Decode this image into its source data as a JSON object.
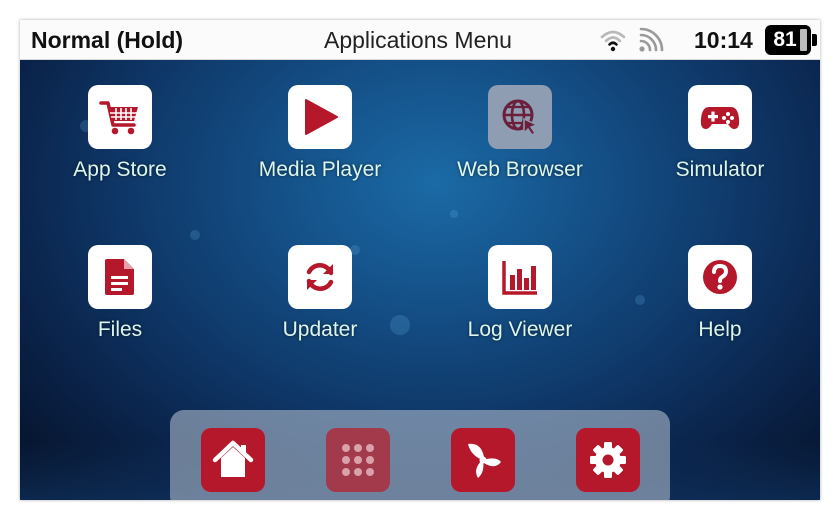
{
  "status_bar": {
    "mode": "Normal (Hold)",
    "title": "Applications Menu",
    "icons": [
      "wifi-icon",
      "cast-signal-icon"
    ],
    "time": "10:14",
    "battery_level": "81"
  },
  "apps": [
    {
      "label": "App Store",
      "icon": "shopping-cart-icon"
    },
    {
      "label": "Media Player",
      "icon": "play-icon"
    },
    {
      "label": "Web Browser",
      "icon": "globe-cursor-icon",
      "selected": true
    },
    {
      "label": "Simulator",
      "icon": "gamepad-icon"
    },
    {
      "label": "Files",
      "icon": "document-icon"
    },
    {
      "label": "Updater",
      "icon": "refresh-icon"
    },
    {
      "label": "Log Viewer",
      "icon": "bar-chart-icon"
    },
    {
      "label": "Help",
      "icon": "help-circle-icon"
    }
  ],
  "dock": [
    {
      "icon": "home-icon"
    },
    {
      "icon": "app-grid-icon",
      "active": true
    },
    {
      "icon": "fan-icon"
    },
    {
      "icon": "gear-icon"
    }
  ],
  "colors": {
    "accent": "#b5182a",
    "label_text": "#dcf6ee",
    "status_bar_bg": "#fbfbfb"
  }
}
